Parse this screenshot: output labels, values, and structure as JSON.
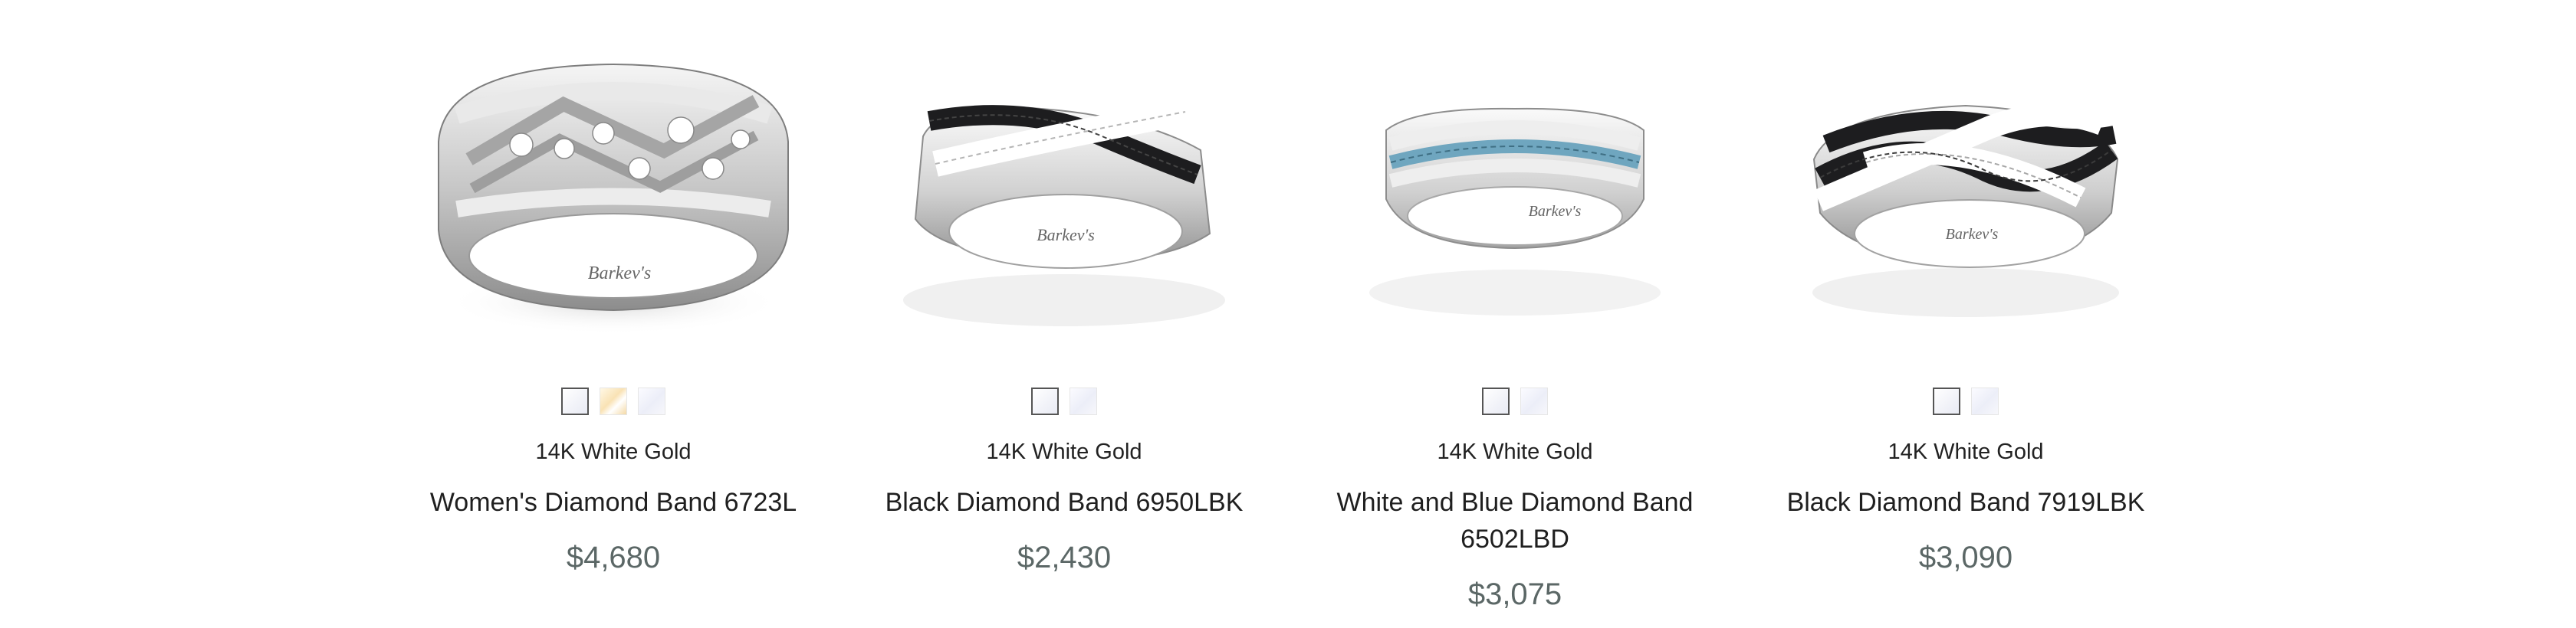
{
  "products": [
    {
      "image_name": "diamond-band-ring-image",
      "swatches": [
        "white",
        "yellow",
        "platinum"
      ],
      "metal": "14K White Gold",
      "name": "Women's Diamond Band 6723L",
      "price": "$4,680",
      "engraving": "Barkev's"
    },
    {
      "image_name": "black-diamond-band-ring-image",
      "swatches": [
        "white",
        "platinum"
      ],
      "metal": "14K White Gold",
      "name": "Black Diamond Band 6950LBK",
      "price": "$2,430",
      "engraving": "Barkev's"
    },
    {
      "image_name": "white-blue-diamond-band-ring-image",
      "swatches": [
        "white",
        "platinum"
      ],
      "metal": "14K White Gold",
      "name": "White and Blue Diamond Band 6502LBD",
      "price": "$3,075",
      "engraving": "Barkev's"
    },
    {
      "image_name": "black-diamond-crossover-band-ring-image",
      "swatches": [
        "white",
        "platinum"
      ],
      "metal": "14K White Gold",
      "name": "Black Diamond Band 7919LBK",
      "price": "$3,090",
      "engraving": "Barkev's"
    }
  ],
  "colors": {
    "price": "#5b6766",
    "text": "#1f1f1f",
    "swatch_border_selected": "#555555",
    "black_stone": "#1d1d1f",
    "blue_stone": "#6fa6bf"
  }
}
